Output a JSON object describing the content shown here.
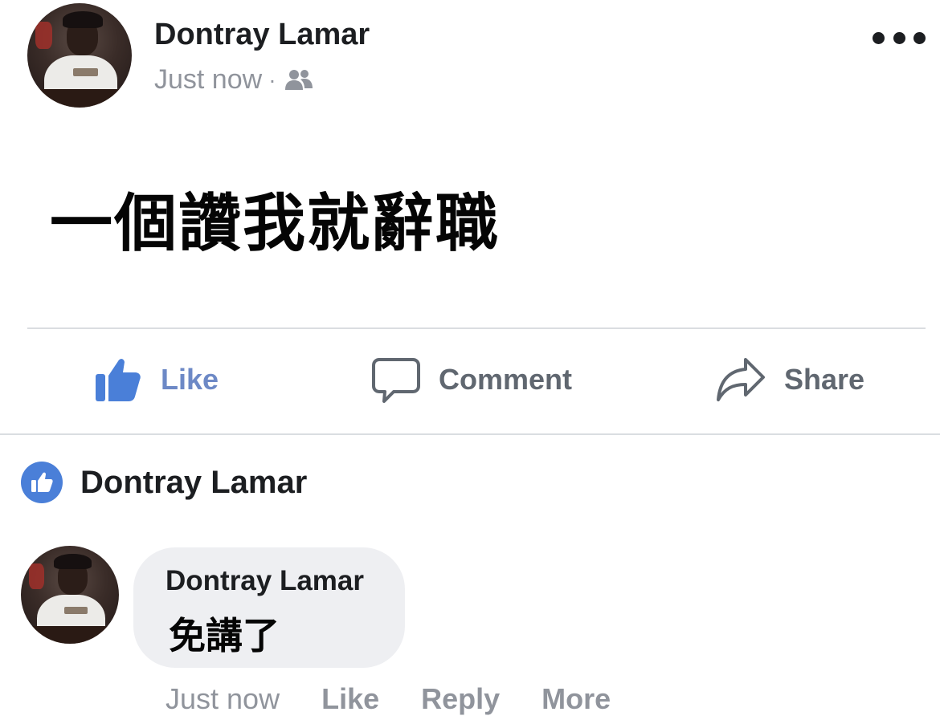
{
  "post": {
    "author": "Dontray Lamar",
    "timestamp": "Just now",
    "separator": "·",
    "audience_icon": "friends-icon",
    "body": "一個讚我就辭職",
    "menu_icon": "more-dots-icon"
  },
  "actions": {
    "like": "Like",
    "comment": "Comment",
    "share": "Share"
  },
  "reaction": {
    "icon": "like-badge-icon",
    "name": "Dontray Lamar"
  },
  "comment": {
    "author": "Dontray Lamar",
    "text": "免講了",
    "timestamp": "Just now",
    "like": "Like",
    "reply": "Reply",
    "more": "More"
  },
  "colors": {
    "like_blue": "#4a7fd8",
    "muted_gray": "#90949c",
    "action_gray": "#606770",
    "bubble_bg": "#eeeff2",
    "divider": "#dadde1"
  }
}
